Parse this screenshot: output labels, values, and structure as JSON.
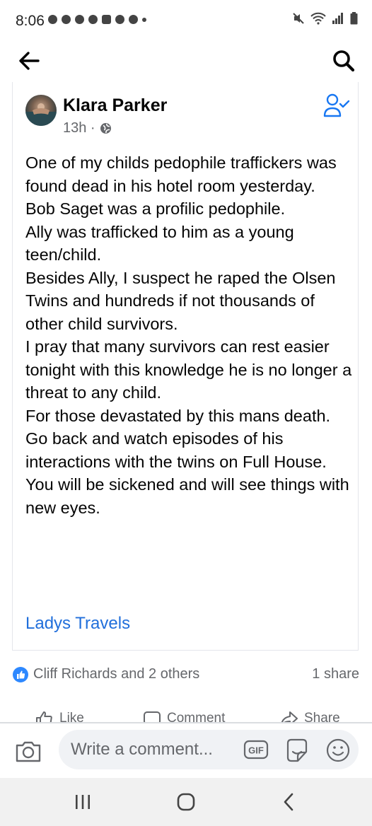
{
  "status_bar": {
    "time": "8:06",
    "left_icons": [
      "settings-icon",
      "messenger-icon",
      "messenger-icon",
      "messenger-icon",
      "chat-icon",
      "facebook-icon",
      "facebook-icon",
      "dot-icon"
    ],
    "right_icons": [
      "mute-icon",
      "wifi-icon",
      "signal-icon",
      "battery-icon"
    ]
  },
  "app_bar": {
    "back_icon": "arrow-left-icon",
    "search_icon": "search-icon"
  },
  "post": {
    "author": "Klara Parker",
    "time": "13h ·",
    "privacy_icon": "globe-icon",
    "follow_icon": "person-check-icon",
    "lines": [
      "One of my childs pedophile traffickers was found dead in his hotel room yesterday.",
      "Bob Saget was a profilic pedophile.",
      "Ally was trafficked to him as a young teen/child.",
      "Besides Ally, I suspect he raped the Olsen Twins and hundreds if not thousands of other child survivors.",
      "I pray that many survivors can rest easier tonight with this knowledge he is no longer a threat to any child.",
      "For those devastated by this mans death.",
      "Go back and watch episodes of his interactions with the twins on Full House.",
      "You will be sickened and will see things with new eyes."
    ],
    "page_link": "Ladys Travels"
  },
  "reactions": {
    "names": "Cliff Richards and 2 others",
    "shares": "1 share"
  },
  "actions": {
    "like": "Like",
    "comment": "Comment",
    "share": "Share"
  },
  "composer": {
    "placeholder": "Write a comment...",
    "gif_label": "GIF"
  },
  "colors": {
    "link": "#216fdb",
    "secondary_text": "#65676b",
    "like_blue": "#2d88ff"
  }
}
